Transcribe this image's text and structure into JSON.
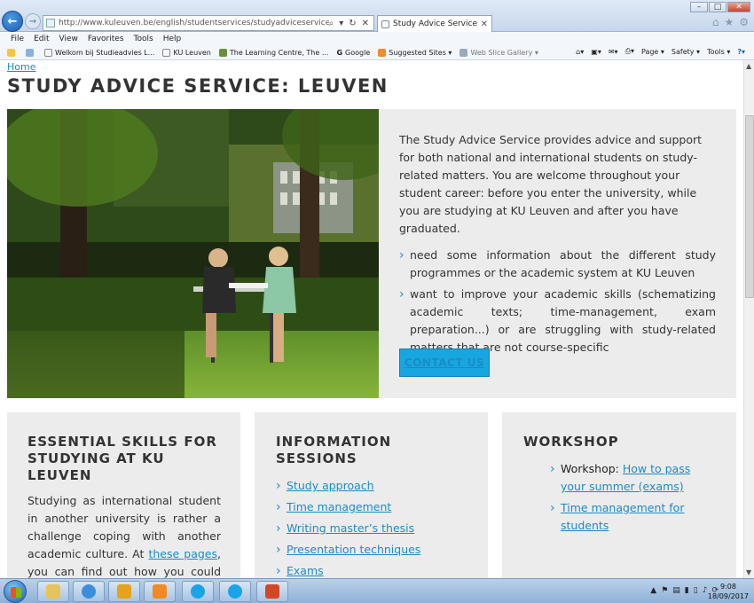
{
  "browser": {
    "url": "http://www.kuleuven.be/english/studentservices/studyadviceservice",
    "tab_title": "Study Advice Service: Leuv...",
    "menu": [
      "File",
      "Edit",
      "View",
      "Favorites",
      "Tools",
      "Help"
    ],
    "favorites": [
      "Welkom bij Studieadvies L...",
      "KU Leuven",
      "The Learning Centre, The ...",
      "Google",
      "Suggested Sites ▾",
      "Web Slice Gallery ▾"
    ],
    "commands": [
      "Page ▾",
      "Safety ▾",
      "Tools ▾"
    ]
  },
  "page": {
    "breadcrumb": "Home",
    "title": "STUDY ADVICE SERVICE: LEUVEN",
    "intro": "The Study Advice Service provides advice and support for both national and international students on study-related matters. You are welcome throughout your student career: before you enter the university, while you are studying at KU Leuven and after you have graduated.",
    "bullets": [
      "need some information about the different study programmes or the academic system at KU Leuven",
      "want to improve your academic skills (schematizing academic texts; time-management, exam preparation...) or are struggling with study-related matters that are not course-specific"
    ],
    "contact_label": "CONTACT US"
  },
  "cards": {
    "skills": {
      "title": "ESSENTIAL SKILLS FOR STUDYING AT KU LEUVEN",
      "text_before": "Studying as international student in another university is rather a challenge coping with another academic culture. At ",
      "link": "these pages",
      "text_after": ", you can find out how you could approach or improve your study at KU Leuven."
    },
    "sessions": {
      "title": "INFORMATION SESSIONS",
      "links": [
        "Study approach",
        "Time management",
        "Writing master’s thesis",
        "Presentation techniques",
        "Exams"
      ]
    },
    "workshop": {
      "title": "WORKSHOP",
      "item1_prefix": "Workshop: ",
      "item1_link": "How to pass your summer (exams)",
      "item2_link": "Time management for students"
    }
  },
  "taskbar": {
    "time": "9:08",
    "date": "18/09/2017"
  }
}
